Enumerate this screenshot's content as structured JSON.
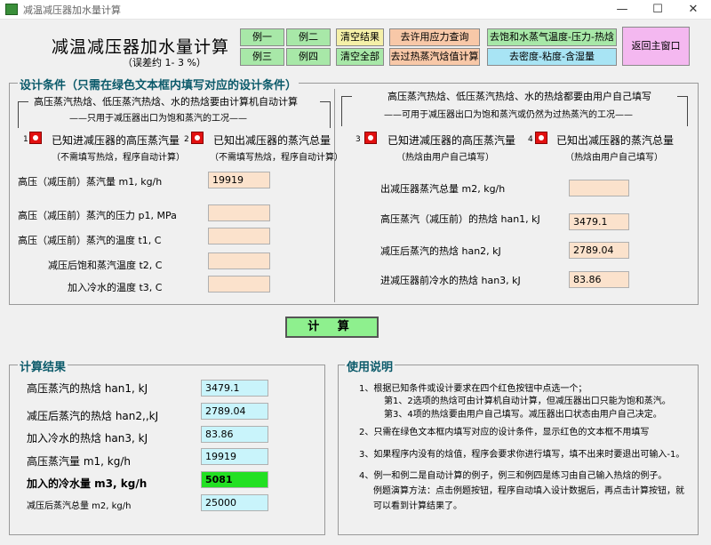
{
  "window": {
    "title": "减温减压器加水量计算",
    "minimize": "—",
    "maximize": "☐",
    "close": "✕"
  },
  "header": {
    "title": "减温减压器加水量计算",
    "subtitle": "（误差约 1- 3 %）"
  },
  "toolbar": {
    "ex1": "例一",
    "ex2": "例二",
    "ex3": "例三",
    "ex4": "例四",
    "clear_results": "清空结果",
    "clear_all": "清空全部",
    "stress_query": "去许用应力查询",
    "enthalpy_calc": "去过热蒸汽焓值计算",
    "saturation": "去饱和水蒸气温度-压力-热焓",
    "density": "去密度-粘度-含湿量",
    "back": "返回主窗口"
  },
  "design": {
    "legend": "设计条件（只需在绿色文本框内填写对应的设计条件）",
    "left_head": "高压蒸汽热焓、低压蒸汽热焓、水的热焓要由计算机自动计算",
    "left_sub": "只用于减压器出口为饱和蒸汽的工况",
    "right_head": "高压蒸汽热焓、低压蒸汽热焓、水的热焓都要由用户自己填写",
    "right_sub": "可用于减压器出口为饱和蒸汽或仍然为过热蒸汽的工况",
    "options": [
      {
        "num": "1",
        "label": "已知进减压器的高压蒸汽量",
        "note": "（不需填写热焓，程序自动计算）"
      },
      {
        "num": "2",
        "label": "已知出减压器的蒸汽总量",
        "note": "（不需填写热焓，程序自动计算）"
      },
      {
        "num": "3",
        "label": "已知进减压器的高压蒸汽量",
        "note": "（热焓由用户自己填写）"
      },
      {
        "num": "4",
        "label": "已知出减压器的蒸汽总量",
        "note": "（热焓由用户自己填写）"
      }
    ],
    "left_fields": [
      {
        "label": "高压（减压前）蒸汽量 m1, kg/h",
        "value": "19919"
      },
      {
        "label": "高压（减压前）蒸汽的压力 p1, MPa",
        "value": ""
      },
      {
        "label": "高压（减压前）蒸汽的温度 t1, C",
        "value": ""
      },
      {
        "label": "减压后饱和蒸汽温度 t2, C",
        "value": ""
      },
      {
        "label": "加入冷水的温度 t3, C",
        "value": ""
      }
    ],
    "right_fields": [
      {
        "label": "出减压器蒸汽总量 m2, kg/h",
        "value": ""
      },
      {
        "label": "高压蒸汽（减压前）的热焓 han1, kJ",
        "value": "3479.1"
      },
      {
        "label": "减压后蒸汽的热焓 han2, kJ",
        "value": "2789.04"
      },
      {
        "label": "进减压器前冷水的热焓 han3, kJ",
        "value": "83.86"
      }
    ]
  },
  "calculate": "计  算",
  "results": {
    "legend": "计算结果",
    "rows": [
      {
        "label": "高压蒸汽的热焓 han1, kJ",
        "value": "3479.1"
      },
      {
        "label": "减压后蒸汽的热焓 han2,,kJ",
        "value": "2789.04"
      },
      {
        "label": "加入冷水的热焓 han3, kJ",
        "value": "83.86"
      },
      {
        "label": "高压蒸汽量 m1, kg/h",
        "value": "19919"
      },
      {
        "label": "加入的冷水量 m3, kg/h",
        "value": "5081"
      },
      {
        "label": "减压后蒸汽总量 m2, kg/h",
        "value": "25000"
      }
    ]
  },
  "help": {
    "legend": "使用说明",
    "lines": [
      "1、根据已知条件或设计要求在四个红色按钮中点选一个；",
      "第1、2选项的热焓可由计算机自动计算，但减压器出口只能为饱和蒸汽。",
      "第3、4项的热焓要由用户自己填写。减压器出口状态由用户自己决定。",
      "2、只需在绿色文本框内填写对应的设计条件，显示红色的文本框不用填写",
      "3、如果程序内没有的焓值，程序会要求你进行填写，填不出来时要退出可输入-1。",
      "4、例一和例二是自动计算的例子，例三和例四是练习由自己输入热焓的例子。",
      "例题演算方法：点击例题按钮，程序自动填入设计数据后，再点击计算按钮，就",
      "可以看到计算结果了。"
    ]
  },
  "colors": {
    "title_green": "#3a8f3a",
    "legend_teal": "#0b5a6a",
    "radio_red": "#e21010",
    "input_peach": "#fbe2cc",
    "input_cyan": "#c9f4fb",
    "highlight_green": "#22e022",
    "calc_button": "#8ef08e"
  }
}
